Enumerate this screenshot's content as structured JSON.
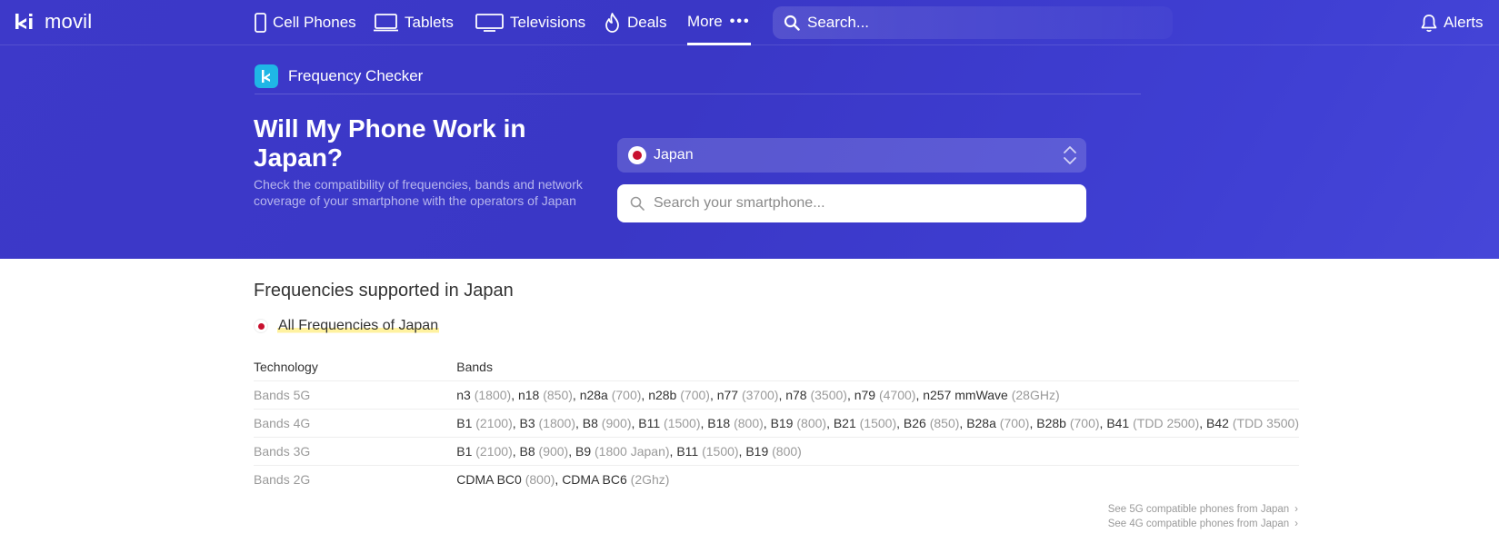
{
  "brand": {
    "logo_text": "movil"
  },
  "nav": {
    "items": [
      {
        "label": "Cell Phones",
        "icon": "phone-icon"
      },
      {
        "label": "Tablets",
        "icon": "tablet-icon"
      },
      {
        "label": "Televisions",
        "icon": "tv-icon"
      },
      {
        "label": "Deals",
        "icon": "flame-icon"
      }
    ],
    "more_label": "More",
    "more_dots": "•••",
    "search_placeholder": "Search...",
    "alerts_label": "Alerts"
  },
  "section": {
    "title": "Frequency Checker"
  },
  "hero": {
    "title": "Will My Phone Work in Japan?",
    "description": "Check the compatibility of frequencies, bands and network coverage of your smartphone with the operators of Japan",
    "country_selected": "Japan",
    "phone_search_placeholder": "Search your smartphone..."
  },
  "frequencies": {
    "heading": "Frequencies supported in Japan",
    "all_link": "All Frequencies of Japan",
    "columns": [
      "Technology",
      "Bands"
    ],
    "rows": [
      {
        "tech": "Bands 5G",
        "bands": [
          [
            "n3",
            "(1800)"
          ],
          [
            "n18",
            "(850)"
          ],
          [
            "n28a",
            "(700)"
          ],
          [
            "n28b",
            "(700)"
          ],
          [
            "n77",
            "(3700)"
          ],
          [
            "n78",
            "(3500)"
          ],
          [
            "n79",
            "(4700)"
          ],
          [
            "n257 mmWave",
            "(28GHz)"
          ]
        ]
      },
      {
        "tech": "Bands 4G",
        "bands": [
          [
            "B1",
            "(2100)"
          ],
          [
            "B3",
            "(1800)"
          ],
          [
            "B8",
            "(900)"
          ],
          [
            "B11",
            "(1500)"
          ],
          [
            "B18",
            "(800)"
          ],
          [
            "B19",
            "(800)"
          ],
          [
            "B21",
            "(1500)"
          ],
          [
            "B26",
            "(850)"
          ],
          [
            "B28a",
            "(700)"
          ],
          [
            "B28b",
            "(700)"
          ],
          [
            "B41",
            "(TDD 2500)"
          ],
          [
            "B42",
            "(TDD 3500)"
          ]
        ]
      },
      {
        "tech": "Bands 3G",
        "bands": [
          [
            "B1",
            "(2100)"
          ],
          [
            "B8",
            "(900)"
          ],
          [
            "B9",
            "(1800 Japan)"
          ],
          [
            "B11",
            "(1500)"
          ],
          [
            "B19",
            "(800)"
          ]
        ]
      },
      {
        "tech": "Bands 2G",
        "bands": [
          [
            "CDMA BC0",
            "(800)"
          ],
          [
            "CDMA BC6",
            "(2Ghz)"
          ]
        ]
      }
    ],
    "links": [
      "See 5G compatible phones from Japan",
      "See 4G compatible phones from Japan"
    ]
  },
  "colors": {
    "hero_bg": "#3d39c9",
    "flag_red": "#c8102e",
    "highlight": "#fff2a0",
    "fc_icon": "#1fb6e6"
  }
}
